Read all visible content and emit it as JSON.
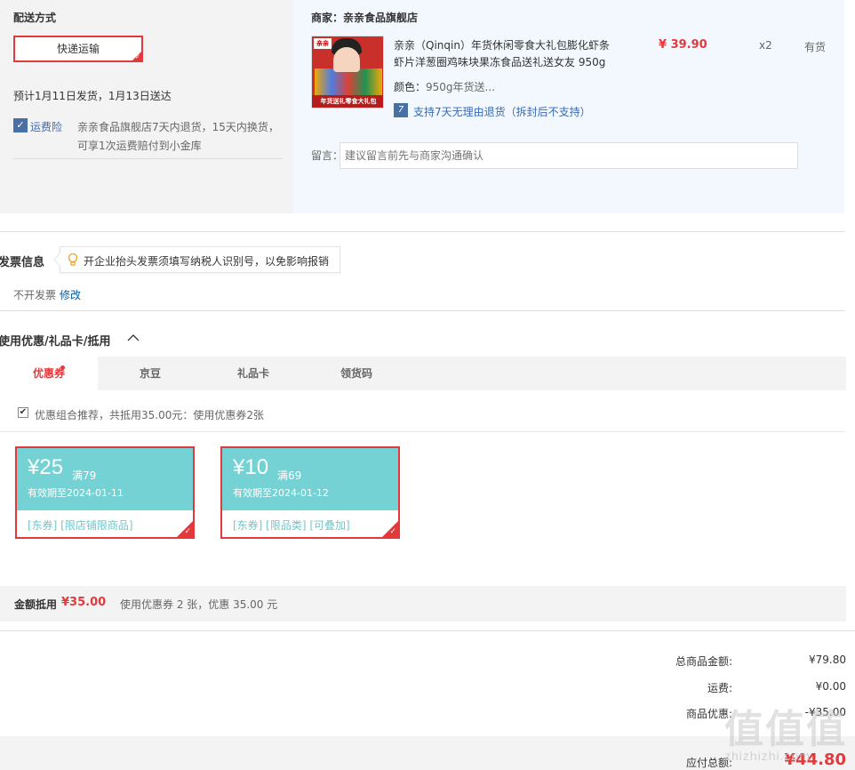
{
  "delivery": {
    "title": "配送方式",
    "method_button": "快递运输",
    "estimate": "预计1月11日发货，1月13日送达",
    "insurance_label": "运费险",
    "insurance_desc_line1": "亲亲食品旗舰店7天内退货，15天内换货，",
    "insurance_desc_line2": "可享1次运费赔付到小金库"
  },
  "shop": {
    "merchant_label": "商家：",
    "merchant_name": "亲亲食品旗舰店",
    "product": {
      "title_line1": "亲亲（Qinqin）年货休闲零食大礼包膨化虾条",
      "title_line2": "虾片洋葱圈鸡味块果冻食品送礼送女友 950g",
      "price": "¥ 39.90",
      "quantity": "x2",
      "stock": "有货",
      "color_label": "颜色：",
      "color_value": "950g年货送...",
      "return_policy": "支持7天无理由退货（拆封后不支持）",
      "image_brand": "亲亲",
      "image_banner": "年货送礼零食大礼包"
    },
    "message_label": "留言：",
    "message_placeholder": "建议留言前先与商家沟通确认"
  },
  "invoice": {
    "title": "发票信息",
    "tip": "开企业抬头发票须填写纳税人识别号，以免影响报销",
    "status": "不开发票",
    "edit": "修改"
  },
  "discount": {
    "title": "使用优惠/礼品卡/抵用",
    "tabs": [
      "优惠券",
      "京豆",
      "礼品卡",
      "领货码"
    ],
    "recommend": "优惠组合推荐，共抵用35.00元：使用优惠券2张",
    "coupons": [
      {
        "amount": "¥25",
        "condition": "满79",
        "expiry": "有效期至2024-01-11",
        "tags": "[东券]  [限店铺限商品]"
      },
      {
        "amount": "¥10",
        "condition": "满69",
        "expiry": "有效期至2024-01-12",
        "tags": "[东券]  [限品类]  [可叠加]"
      }
    ],
    "summary_label": "金额抵用",
    "summary_amount": "¥35.00",
    "summary_desc": "使用优惠券 2 张，优惠 35.00 元"
  },
  "totals": {
    "goods_label": "总商品金额:",
    "goods_value": "¥79.80",
    "shipping_label": "运费:",
    "shipping_value": "¥0.00",
    "discount_label": "商品优惠:",
    "discount_value": "-¥35.00",
    "pay_label": "应付总额:",
    "pay_value": "¥44.80"
  },
  "watermark": {
    "mark": "值值值",
    "site": "zhizhizhi.com"
  },
  "colors": {
    "accent": "#e4393c",
    "coupon_teal": "#74d2d4",
    "link_blue": "#3a6ab3"
  }
}
